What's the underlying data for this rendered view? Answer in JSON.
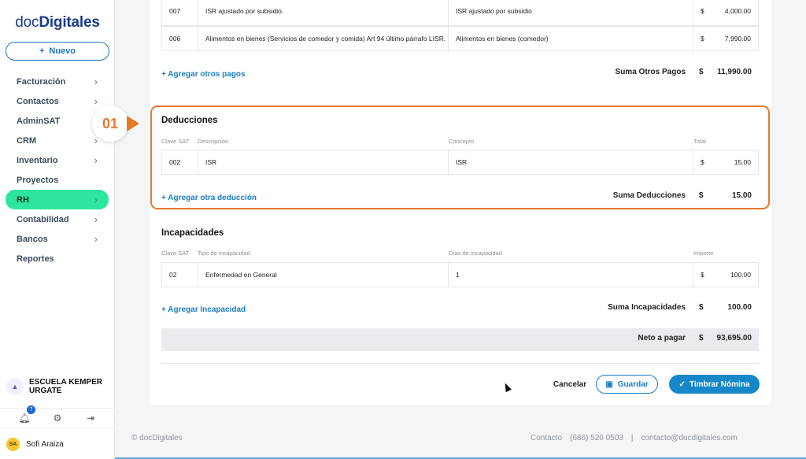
{
  "brand": {
    "prefix": "doc",
    "name": "Digitales"
  },
  "sidebar": {
    "new_button": "Nuevo",
    "items": [
      {
        "label": "Facturación",
        "chevron": true
      },
      {
        "label": "Contactos",
        "chevron": true
      },
      {
        "label": "AdminSAT",
        "chevron": false
      },
      {
        "label": "CRM",
        "chevron": true
      },
      {
        "label": "Inventario",
        "chevron": true
      },
      {
        "label": "Proyectos",
        "chevron": false
      },
      {
        "label": "RH",
        "chevron": true,
        "active": true
      },
      {
        "label": "Contabilidad",
        "chevron": true
      },
      {
        "label": "Bancos",
        "chevron": true
      },
      {
        "label": "Reportes",
        "chevron": false
      }
    ],
    "org_name": "ESCUELA KEMPER URGATE",
    "notifications_count": "7",
    "user": {
      "initials": "SA",
      "name": "Sofi Araiza"
    }
  },
  "otros_pagos": {
    "rows": [
      {
        "clave": "007",
        "descripcion": "ISR ajustado por subsidio.",
        "concepto": "ISR ajustado por subsidio",
        "currency": "$",
        "total": "4,000.00"
      },
      {
        "clave": "006",
        "descripcion": "Alimentos en bienes (Servicios de comedor y comida) Art 94 último párrafo LISR.",
        "concepto": "Alimentos en bienes (comedor)",
        "currency": "$",
        "total": "7,990.00"
      }
    ],
    "add_link": "+ Agregar otros pagos",
    "sum_label": "Suma Otros Pagos",
    "sum_currency": "$",
    "sum_value": "11,990.00"
  },
  "deducciones": {
    "title": "Deducciones",
    "headers": {
      "clave": "Clave SAT",
      "descripcion": "Descripción",
      "concepto": "Concepto",
      "total": "Total"
    },
    "rows": [
      {
        "clave": "002",
        "descripcion": "ISR",
        "concepto": "ISR",
        "currency": "$",
        "total": "15.00"
      }
    ],
    "add_link": "+ Agregar otra deducción",
    "sum_label": "Suma Deducciones",
    "sum_currency": "$",
    "sum_value": "15.00"
  },
  "incapacidades": {
    "title": "Incapacidades",
    "headers": {
      "clave": "Clave SAT",
      "tipo": "Tipo de incapacidad",
      "dias": "Días de incapacidad",
      "importe": "Importe"
    },
    "rows": [
      {
        "clave": "02",
        "tipo": "Enfermedad en General",
        "dias": "1",
        "currency": "$",
        "importe": "100.00"
      }
    ],
    "add_link": "+ Agregar Incapacidad",
    "sum_label": "Suma Incapacidades",
    "sum_currency": "$",
    "sum_value": "100.00"
  },
  "neto": {
    "label": "Neto a pagar",
    "currency": "$",
    "value": "93,695.00"
  },
  "callout": {
    "number": "01",
    "color": "#e8782a"
  },
  "actions": {
    "cancel": "Cancelar",
    "save": "Guardar",
    "stamp": "Timbrar Nómina"
  },
  "footer": {
    "copyright": "© docDigitales",
    "contact_label": "Contacto",
    "phone": "(686) 520 0503",
    "separator": "|",
    "email": "contacto@docdigitales.com"
  },
  "colors": {
    "accent": "#1a7ec7",
    "active_nav": "#2ee59d",
    "highlight": "#e8782a"
  }
}
